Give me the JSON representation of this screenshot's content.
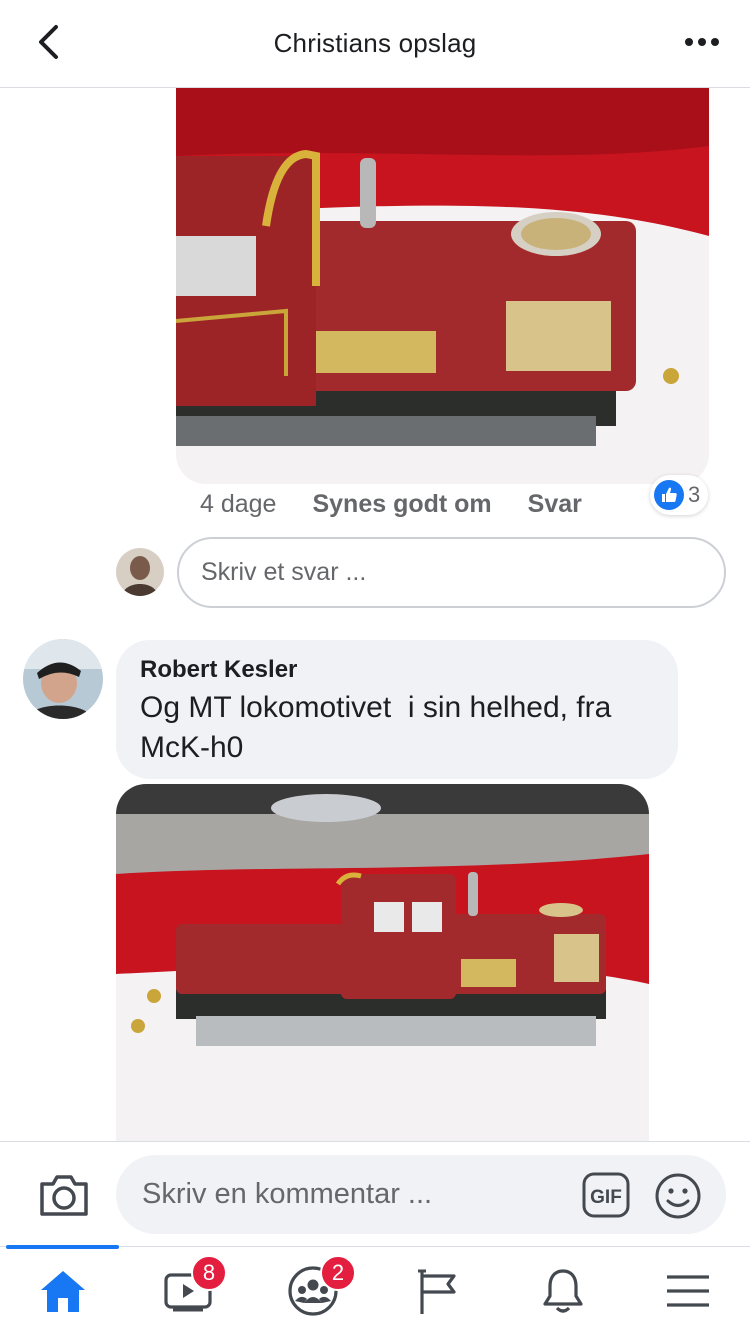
{
  "header": {
    "title": "Christians opslag"
  },
  "comment_reply": {
    "time": "4 dage",
    "like_label": "Synes godt om",
    "reply_label": "Svar",
    "reaction_count": "3"
  },
  "reply_input": {
    "placeholder": "Skriv et svar ..."
  },
  "comment": {
    "author": "Robert Kesler",
    "text": "Og MT lokomotivet  i sin helhed, fra McK-h0"
  },
  "composer": {
    "placeholder": "Skriv en kommentar ...",
    "gif_label": "GIF"
  },
  "tabbar": {
    "items": [
      {
        "name": "home",
        "badge": ""
      },
      {
        "name": "watch",
        "badge": "8"
      },
      {
        "name": "groups",
        "badge": "2"
      },
      {
        "name": "pages",
        "badge": ""
      },
      {
        "name": "notifications",
        "badge": ""
      },
      {
        "name": "menu",
        "badge": ""
      }
    ]
  },
  "colors": {
    "accent": "#1877f2",
    "badge": "#e41e3f",
    "bubble_bg": "#f0f2f5",
    "muted_text": "#65676b"
  }
}
